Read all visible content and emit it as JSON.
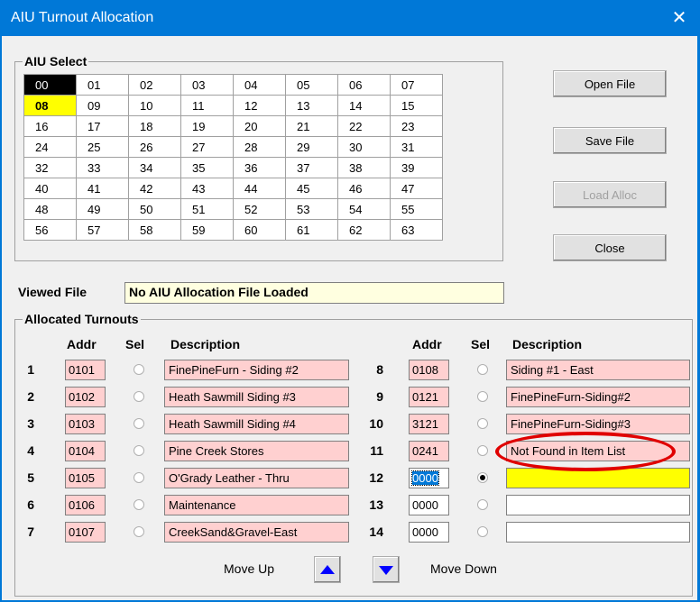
{
  "window": {
    "title": "AIU Turnout Allocation",
    "close_glyph": "✕"
  },
  "aiu_select": {
    "legend": "AIU Select",
    "rows": [
      [
        "00",
        "01",
        "02",
        "03",
        "04",
        "05",
        "06",
        "07"
      ],
      [
        "08",
        "09",
        "10",
        "11",
        "12",
        "13",
        "14",
        "15"
      ],
      [
        "16",
        "17",
        "18",
        "19",
        "20",
        "21",
        "22",
        "23"
      ],
      [
        "24",
        "25",
        "26",
        "27",
        "28",
        "29",
        "30",
        "31"
      ],
      [
        "32",
        "33",
        "34",
        "35",
        "36",
        "37",
        "38",
        "39"
      ],
      [
        "40",
        "41",
        "42",
        "43",
        "44",
        "45",
        "46",
        "47"
      ],
      [
        "48",
        "49",
        "50",
        "51",
        "52",
        "53",
        "54",
        "55"
      ],
      [
        "56",
        "57",
        "58",
        "59",
        "60",
        "61",
        "62",
        "63"
      ]
    ],
    "highlighted_black": "00",
    "highlighted_yellow": "08"
  },
  "buttons": {
    "open_file": "Open File",
    "save_file": "Save File",
    "load_alloc": "Load Alloc",
    "close": "Close"
  },
  "viewed_file": {
    "label": "Viewed File",
    "value": "No AIU Allocation File Loaded"
  },
  "allocated": {
    "legend": "Allocated Turnouts",
    "headers": {
      "addr": "Addr",
      "sel": "Sel",
      "description": "Description"
    },
    "left": [
      {
        "num": "1",
        "addr": "0101",
        "desc": "FinePineFurn - Siding #2"
      },
      {
        "num": "2",
        "addr": "0102",
        "desc": "Heath Sawmill Siding #3"
      },
      {
        "num": "3",
        "addr": "0103",
        "desc": "Heath Sawmill Siding #4"
      },
      {
        "num": "4",
        "addr": "0104",
        "desc": "Pine Creek Stores"
      },
      {
        "num": "5",
        "addr": "0105",
        "desc": "O'Grady Leather - Thru"
      },
      {
        "num": "6",
        "addr": "0106",
        "desc": "Maintenance"
      },
      {
        "num": "7",
        "addr": "0107",
        "desc": "CreekSand&Gravel-East"
      }
    ],
    "right": [
      {
        "num": "8",
        "addr": "0108",
        "desc": "Siding #1 - East"
      },
      {
        "num": "9",
        "addr": "0121",
        "desc": "FinePineFurn-Siding#2"
      },
      {
        "num": "10",
        "addr": "3121",
        "desc": "FinePineFurn-Siding#3"
      },
      {
        "num": "11",
        "addr": "0241",
        "desc": "Not Found in Item List"
      },
      {
        "num": "12",
        "addr": "0000",
        "desc": ""
      },
      {
        "num": "13",
        "addr": "0000",
        "desc": ""
      },
      {
        "num": "14",
        "addr": "0000",
        "desc": ""
      }
    ],
    "selected_row": "12"
  },
  "move": {
    "up_label": "Move Up",
    "down_label": "Move Down"
  },
  "colors": {
    "title_bar": "#0078d7",
    "pink_field": "#ffd0d0",
    "yellow_highlight": "#ffff00",
    "callout_red": "#e00000",
    "arrow_blue": "#0000ff"
  }
}
